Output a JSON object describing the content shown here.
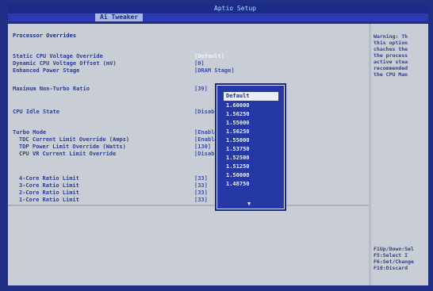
{
  "bios": {
    "title": "Aptio Setup",
    "active_tab": "Ai Tweaker"
  },
  "main": {
    "section_title": "Processor Overrides",
    "rows": [
      {
        "label": "Static CPU Voltage Override",
        "value": "[Default]"
      },
      {
        "label": "Dynamic CPU Voltage Offset (mV)",
        "value": "[0]"
      },
      {
        "label": "Enhanced Power Stage",
        "value": "[DRAM Stage]"
      },
      {
        "label": "Maximum Non-Turbo Ratio",
        "value": "[39]"
      },
      {
        "label": "CPU Idle State",
        "value": "[Disabled]"
      },
      {
        "label": "Turbo Mode",
        "value": "[Enabled]"
      },
      {
        "label": "TDC Current Limit Override (Amps)",
        "value": "[Enabled]"
      },
      {
        "label": "TDP Power Limit Override (Watts)",
        "value": "[130]"
      },
      {
        "label": "CPU VR Current Limit Override",
        "value": "[Disabled]"
      },
      {
        "label": "4-Core Ratio Limit",
        "value": "[33]"
      },
      {
        "label": "3-Core Ratio Limit",
        "value": "[33]"
      },
      {
        "label": "2-Core Ratio Limit",
        "value": "[33]"
      },
      {
        "label": "1-Core Ratio Limit",
        "value": "[33]"
      }
    ]
  },
  "popup": {
    "items": [
      "Default",
      "1.60000",
      "1.56250",
      "1.55000",
      "1.56250",
      "1.55000",
      "1.53750",
      "1.52500",
      "1.51250",
      "1.50000",
      "1.48750"
    ],
    "selected_index": 0,
    "scroll_hint": "▼"
  },
  "help": {
    "top_lines": [
      "Warning: Th",
      "this option",
      "chaches the",
      "the process",
      "active stea",
      "recommended",
      "the CPU Man"
    ],
    "bottom_lines": [
      "F1Up/Down:Sel",
      "F5:Select I",
      "F6:Set/Change",
      "F10:Discard"
    ]
  }
}
